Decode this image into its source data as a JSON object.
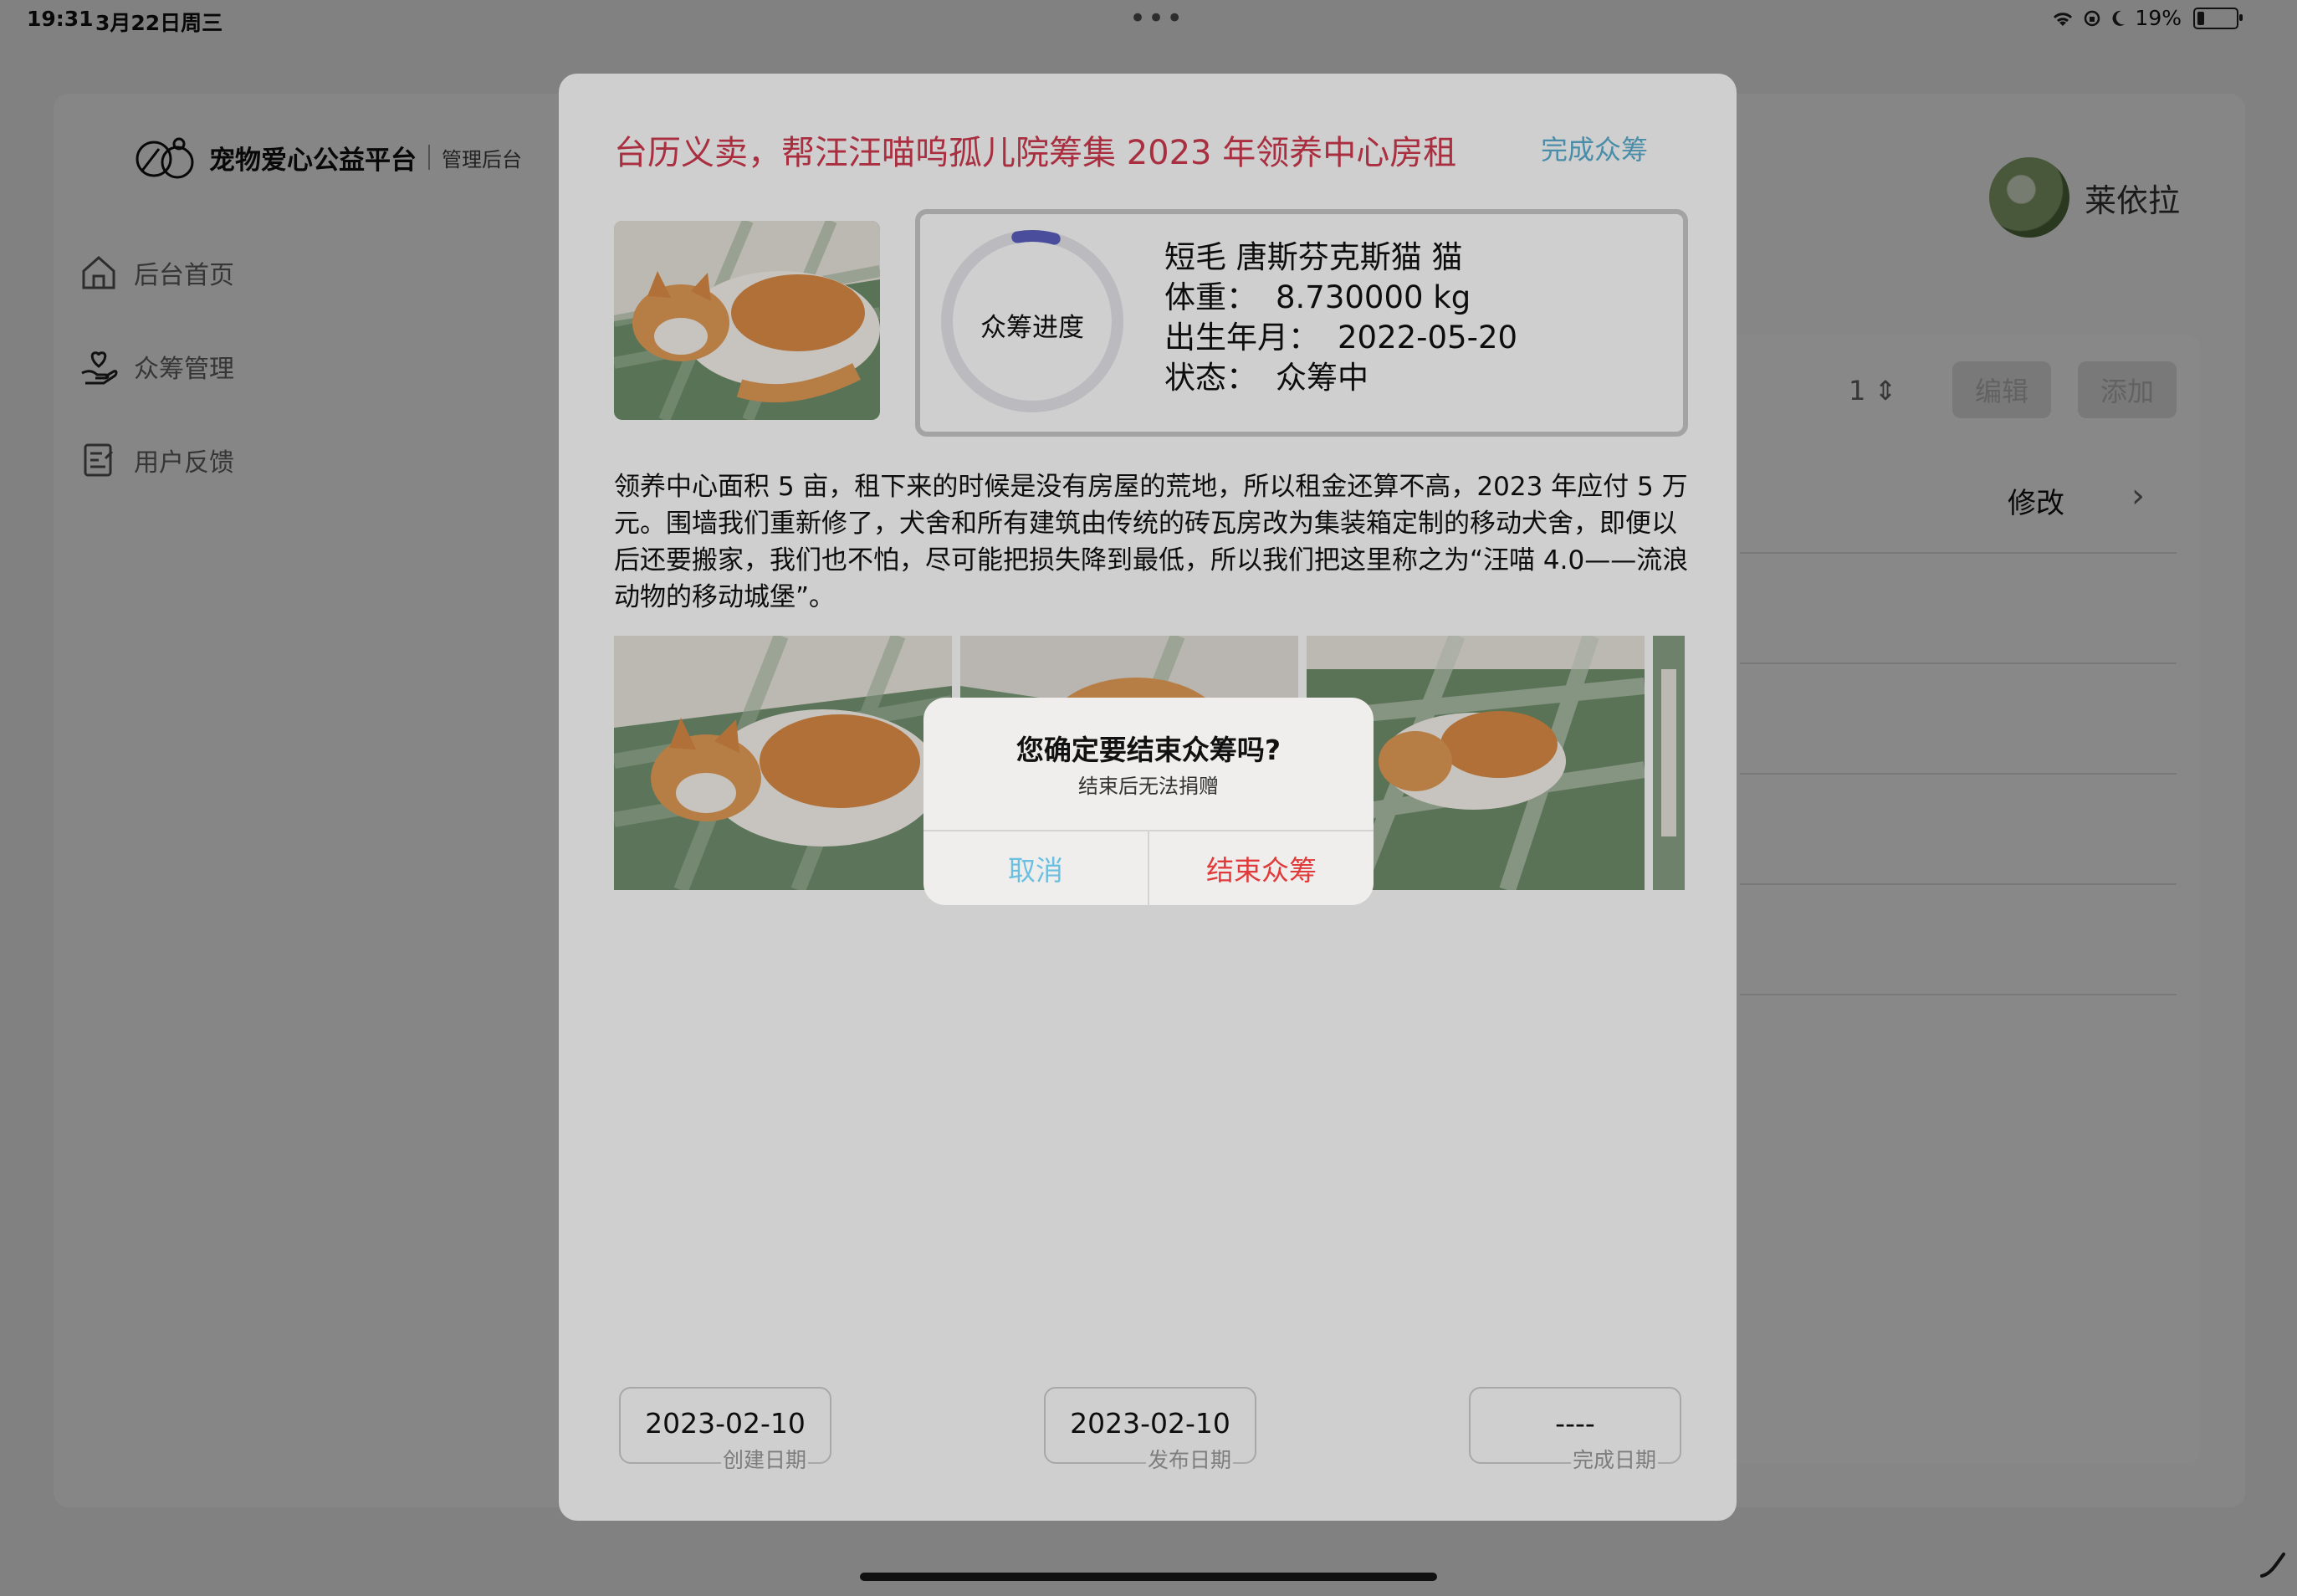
{
  "status": {
    "time": "19:31",
    "date": "3月22日周三",
    "battery": "19%"
  },
  "app": {
    "brand": "宠物爱心公益平台",
    "brand_sub": "管理后台",
    "sidebar": [
      {
        "label": "后台首页",
        "icon": "home-icon"
      },
      {
        "label": "众筹管理",
        "icon": "heart-hand-icon"
      },
      {
        "label": "用户反馈",
        "icon": "feedback-icon"
      }
    ],
    "user": {
      "name": "莱依拉"
    },
    "toolbar": {
      "page": "1",
      "edit_label": "编辑",
      "add_label": "添加"
    },
    "row": {
      "modify_label": "修改"
    }
  },
  "detail": {
    "title": "台历义卖，帮汪汪喵呜孤儿院筹集 2023 年领养中心房租",
    "complete_action": "完成众筹",
    "progress_label": "众筹进度",
    "progress_value": 0.07,
    "info": {
      "breed_line": "短毛  唐斯芬克斯猫  猫",
      "weight_label": "体重：",
      "weight_value": "8.730000 kg",
      "birth_label": "出生年月：",
      "birth_value": "2022-05-20",
      "status_label": "状态：",
      "status_value": "众筹中"
    },
    "description": "领养中心面积 5 亩，租下来的时候是没有房屋的荒地，所以租金还算不高，2023 年应付 5 万元。围墙我们重新修了，犬舍和所有建筑由传统的砖瓦房改为集装箱定制的移动犬舍，即便以后还要搬家，我们也不怕，尽可能把损失降到最低，所以我们把这里称之为“汪喵 4.0——流浪动物的移动城堡”。",
    "dates": [
      {
        "value": "2023-02-10",
        "label": "创建日期"
      },
      {
        "value": "2023-02-10",
        "label": "发布日期"
      },
      {
        "value": "----",
        "label": "完成日期"
      }
    ]
  },
  "alert": {
    "title": "您确定要结束众筹吗?",
    "message": "结束后无法捐赠",
    "cancel_label": "取消",
    "confirm_label": "结束众筹"
  },
  "colors": {
    "title_red": "#d03b4f",
    "link_blue": "#5aaed0",
    "progress": "#5a5fc0",
    "danger": "#e03a3a"
  }
}
